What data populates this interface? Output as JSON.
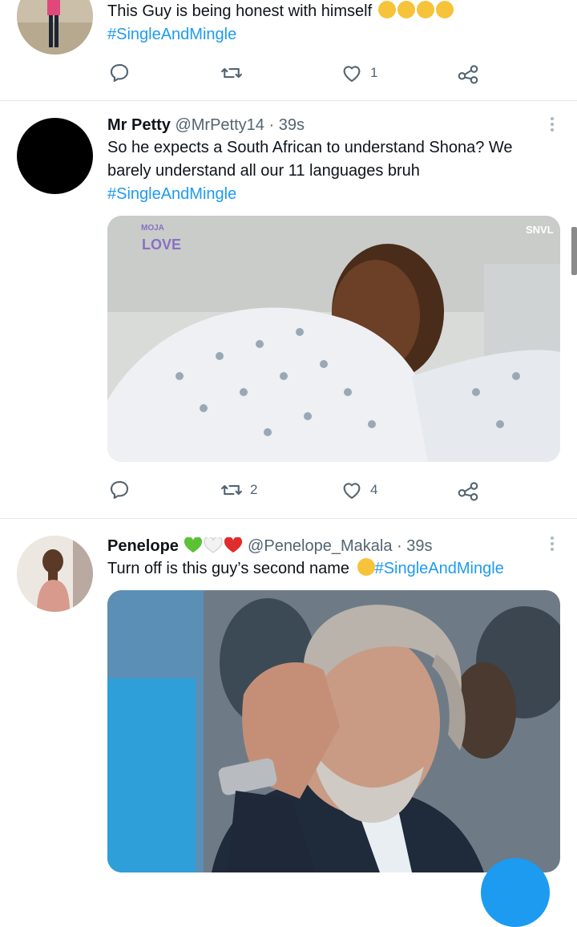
{
  "tweets": [
    {
      "text_line1": "This Guy is being honest with himself",
      "hashtag": "#SingleAndMingle",
      "actions": {
        "reply_count": "",
        "retweet_count": "",
        "like_count": "1"
      }
    },
    {
      "name": "Mr Petty",
      "handle": "@MrPetty14",
      "time": "· 39s",
      "text_line1": "So he expects a South African to understand Shona? We",
      "text_line2": "barely understand all our 11 languages bruh",
      "hashtag": "#SingleAndMingle",
      "media": {
        "logo_top": "MOJA",
        "logo_bottom": "LOVE",
        "corner_mark": "SNVL"
      },
      "actions": {
        "reply_count": "",
        "retweet_count": "2",
        "like_count": "4"
      }
    },
    {
      "name": "Penelope",
      "handle": "@Penelope_Makala",
      "time": "· 39s",
      "text_line1": "Turn off is this guy’s second name",
      "hashtag": "#SingleAndMingle"
    }
  ],
  "icons": [
    "reply-icon",
    "retweet-icon",
    "like-icon",
    "share-icon",
    "more-icon"
  ],
  "colors": {
    "link": "#1d9bf0",
    "secondary": "#536471",
    "divider": "#e1e8ed"
  }
}
